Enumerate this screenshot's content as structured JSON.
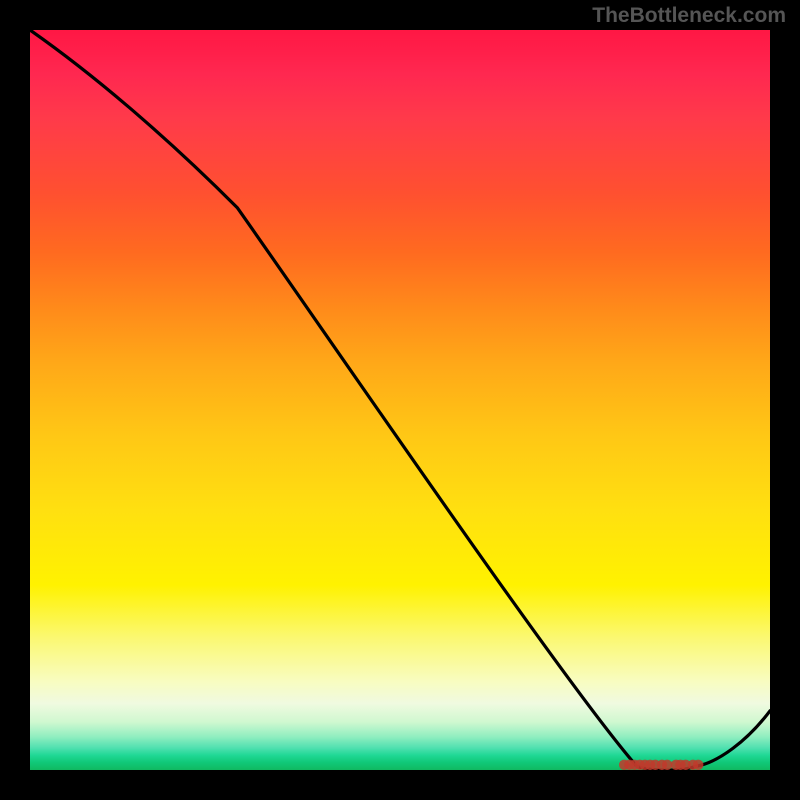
{
  "watermark": "TheBottleneck.com",
  "chart_data": {
    "type": "line",
    "title": "",
    "xlabel": "",
    "ylabel": "",
    "xlim": [
      0,
      100
    ],
    "ylim": [
      0,
      100
    ],
    "series": [
      {
        "name": "curve",
        "x": [
          0,
          28,
          82,
          90,
          100
        ],
        "y": [
          100,
          76,
          0.5,
          0.5,
          8
        ]
      }
    ],
    "markers": {
      "name": "bottom-cluster",
      "x_range": [
        80,
        90
      ],
      "y": 0.7,
      "points": [
        {
          "x": 80.3,
          "y": 0.7
        },
        {
          "x": 81.0,
          "y": 0.7
        },
        {
          "x": 81.7,
          "y": 0.7
        },
        {
          "x": 82.4,
          "y": 0.7
        },
        {
          "x": 83.1,
          "y": 0.7
        },
        {
          "x": 83.8,
          "y": 0.7
        },
        {
          "x": 84.5,
          "y": 0.7
        },
        {
          "x": 85.4,
          "y": 0.7
        },
        {
          "x": 86.1,
          "y": 0.7
        },
        {
          "x": 87.3,
          "y": 0.7
        },
        {
          "x": 87.9,
          "y": 0.7
        },
        {
          "x": 88.6,
          "y": 0.7
        },
        {
          "x": 89.6,
          "y": 0.7
        },
        {
          "x": 90.3,
          "y": 0.7
        }
      ]
    },
    "gradient_stops": [
      {
        "pos": 0,
        "color": "#ff1744"
      },
      {
        "pos": 50,
        "color": "#ffc815"
      },
      {
        "pos": 80,
        "color": "#fff200"
      },
      {
        "pos": 100,
        "color": "#10b860"
      }
    ]
  }
}
